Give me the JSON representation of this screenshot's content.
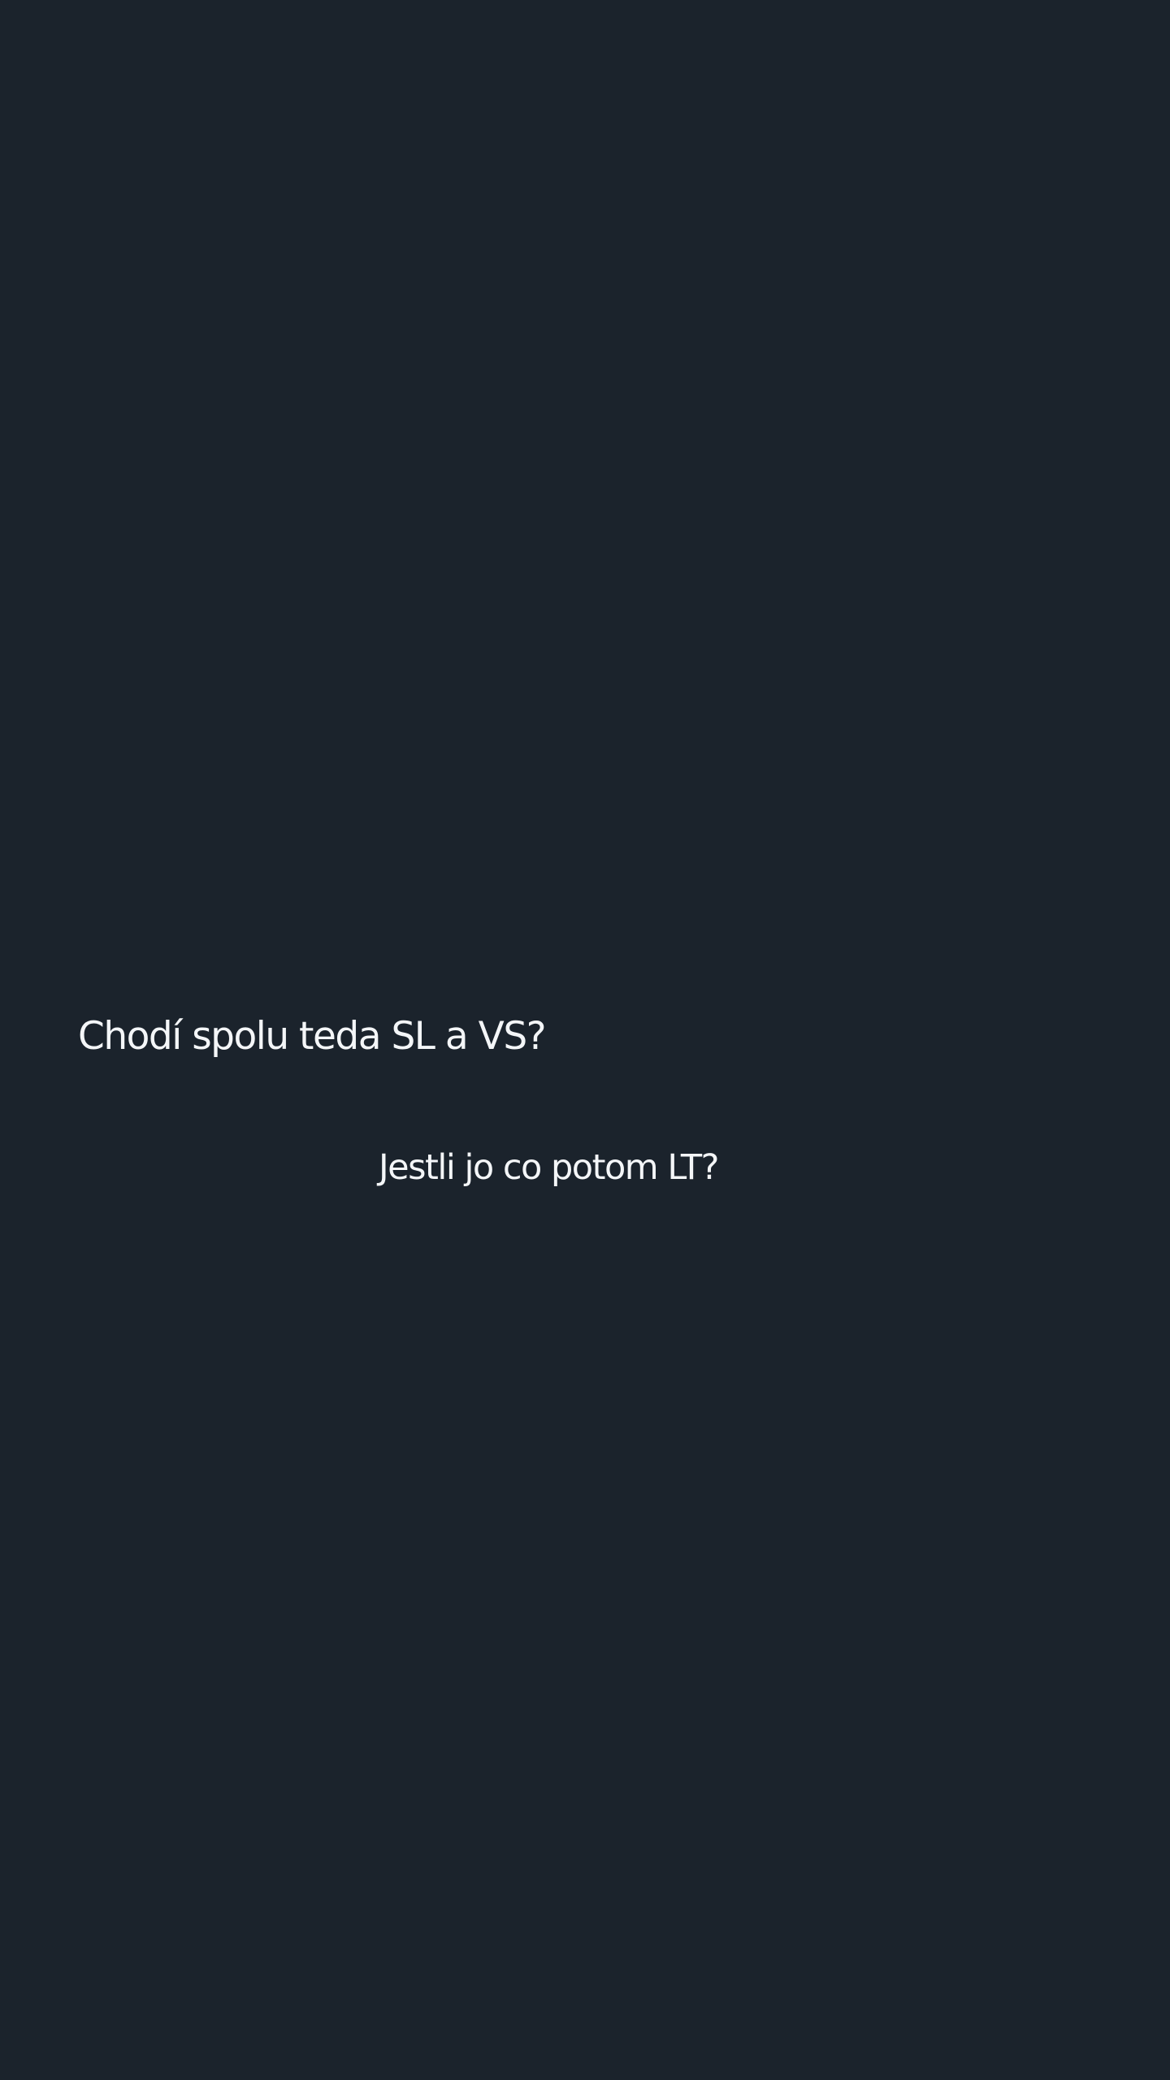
{
  "story": {
    "background_color": "#1b232c",
    "text_color": "#f4f6f8",
    "lines": [
      "Chodí spolu teda SL a VS?",
      "Jestli jo co potom LT?"
    ]
  }
}
